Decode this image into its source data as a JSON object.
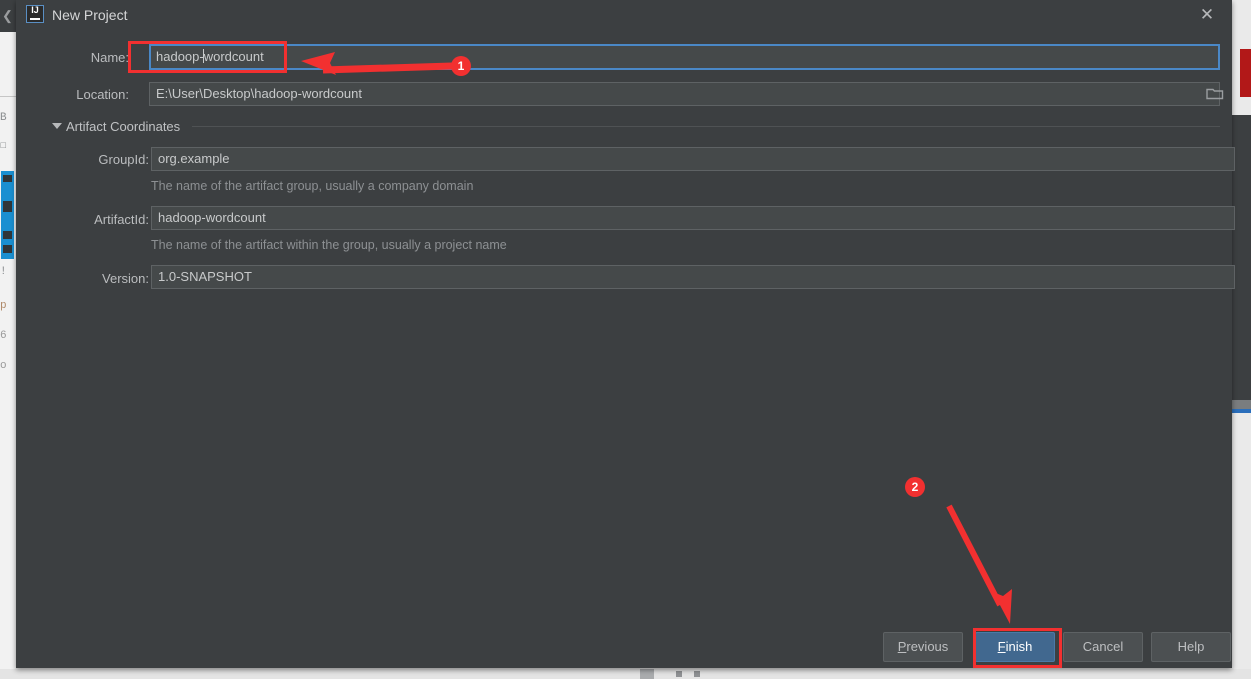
{
  "dialog": {
    "title": "New Project",
    "app_icon": "intellij-idea-icon",
    "close_icon": "close-icon"
  },
  "form": {
    "name": {
      "label": "Name:",
      "value_before_caret": "hadoop-",
      "value_after_caret": "wordcount",
      "full_value": "hadoop-wordcount"
    },
    "location": {
      "label": "Location:",
      "value": "E:\\User\\Desktop\\hadoop-wordcount",
      "browse_icon": "folder-icon"
    }
  },
  "artifact_coordinates": {
    "section_label": "Artifact Coordinates",
    "expanded": true,
    "group_id": {
      "label": "GroupId:",
      "value": "org.example",
      "hint": "The name of the artifact group, usually a company domain"
    },
    "artifact_id": {
      "label": "ArtifactId:",
      "value": "hadoop-wordcount",
      "hint": "The name of the artifact within the group, usually a project name"
    },
    "version": {
      "label": "Version:",
      "value": "1.0-SNAPSHOT"
    }
  },
  "buttons": {
    "previous": {
      "mnemonic": "P",
      "rest": "revious"
    },
    "finish": {
      "mnemonic": "F",
      "rest": "inish"
    },
    "cancel": {
      "label": "Cancel"
    },
    "help": {
      "label": "Help"
    }
  },
  "annotations": {
    "marker_1": "1",
    "marker_2": "2"
  },
  "colors": {
    "dialog_background": "#3c3f41",
    "field_background": "#45494a",
    "focus_border": "#4a88c7",
    "primary_button": "#41688f",
    "annotation_red": "#f23030",
    "hint_text": "#8d9093"
  }
}
